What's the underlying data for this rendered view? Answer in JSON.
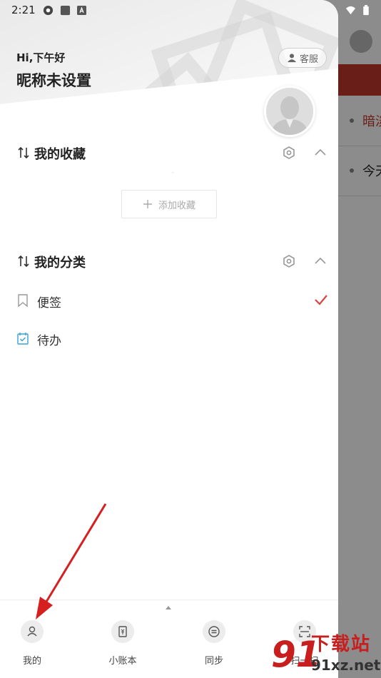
{
  "status_bar": {
    "time": "2:21"
  },
  "header": {
    "greeting": "Hi,下午好",
    "nickname": "昵称未设置",
    "service_label": "客服"
  },
  "favorites": {
    "title": "我的收藏",
    "add_label": "添加收藏"
  },
  "categories": {
    "title": "我的分类",
    "items": [
      {
        "label": "便签",
        "icon": "bookmark-icon",
        "checked": true
      },
      {
        "label": "待办",
        "icon": "calendar-check-icon",
        "checked": false
      }
    ]
  },
  "bottom_nav": {
    "items": [
      {
        "label": "我的",
        "icon": "person-icon"
      },
      {
        "label": "小账本",
        "icon": "ledger-icon"
      },
      {
        "label": "同步",
        "icon": "sync-icon"
      },
      {
        "label": "扫一扫",
        "icon": "scan-icon"
      }
    ]
  },
  "background_app": {
    "rows": [
      "暗淡",
      "今天"
    ]
  },
  "watermark": {
    "number": "91",
    "text_cn": "下载站",
    "url": "91xz.net"
  },
  "colors": {
    "accent": "#d64541",
    "todo_blue": "#3aa0d8",
    "arrow": "#d62020"
  }
}
